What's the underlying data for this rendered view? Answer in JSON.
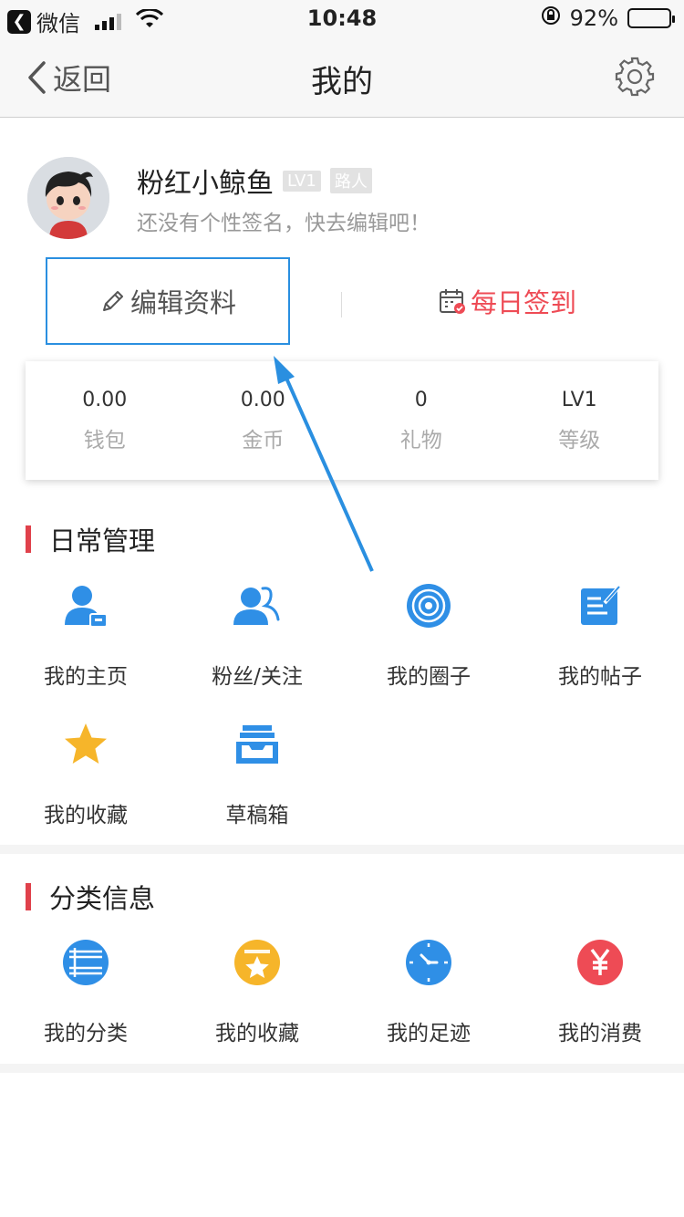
{
  "status_bar": {
    "back_app": "微信",
    "time": "10:48",
    "battery": "92%",
    "battery_level": 0.92
  },
  "nav": {
    "back_label": "返回",
    "title": "我的"
  },
  "profile": {
    "username": "粉红小鲸鱼",
    "level_tag": "LV1",
    "role_tag": "路人",
    "signature": "还没有个性签名，快去编辑吧！",
    "edit_label": "编辑资料",
    "checkin_label": "每日签到"
  },
  "stats": [
    {
      "value": "0.00",
      "label": "钱包"
    },
    {
      "value": "0.00",
      "label": "金币"
    },
    {
      "value": "0",
      "label": "礼物"
    },
    {
      "value": "LV1",
      "label": "等级"
    }
  ],
  "daily": {
    "title": "日常管理",
    "items": [
      {
        "label": "我的主页",
        "icon": "user-card-icon"
      },
      {
        "label": "粉丝/关注",
        "icon": "followers-icon"
      },
      {
        "label": "我的圈子",
        "icon": "circle-icon"
      },
      {
        "label": "我的帖子",
        "icon": "post-edit-icon"
      },
      {
        "label": "我的收藏",
        "icon": "star-icon"
      },
      {
        "label": "草稿箱",
        "icon": "drafts-box-icon"
      }
    ]
  },
  "category": {
    "title": "分类信息",
    "items": [
      {
        "label": "我的分类",
        "icon": "category-list-icon"
      },
      {
        "label": "我的收藏",
        "icon": "favorite-folder-icon"
      },
      {
        "label": "我的足迹",
        "icon": "clock-icon"
      },
      {
        "label": "我的消费",
        "icon": "yen-icon"
      }
    ]
  },
  "colors": {
    "accent_blue": "#2f8fe6",
    "accent_red": "#ee4b55",
    "star_yellow": "#f6b52a",
    "highlight_border": "#2a8fe0"
  }
}
